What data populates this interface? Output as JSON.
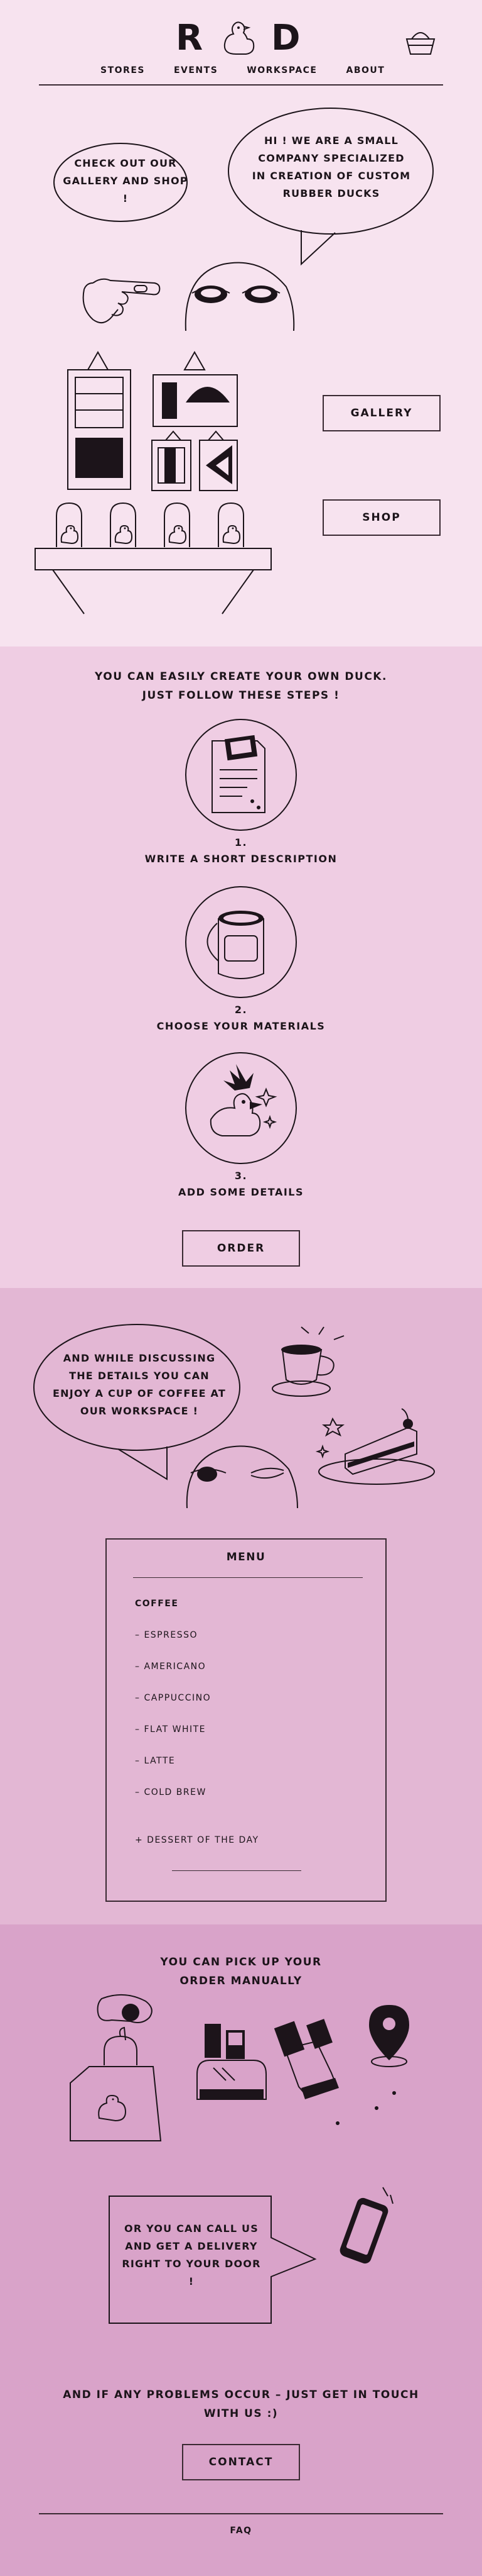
{
  "header": {
    "logo_left": "R",
    "logo_right": "D",
    "nav": [
      "STORES",
      "EVENTS",
      "WORKSPACE",
      "ABOUT"
    ],
    "cart_icon": "basket-icon"
  },
  "hero": {
    "bubble_left": "CHECK OUT OUR GALLERY AND SHOP !",
    "bubble_right": "HI ! WE ARE A SMALL COMPANY SPECIALIZED IN CREATION OF CUSTOM RUBBER DUCKS",
    "gallery_button": "GALLERY",
    "shop_button": "SHOP"
  },
  "steps": {
    "heading_line1": "YOU CAN EASILY CREATE YOUR OWN DUCK.",
    "heading_line2": "JUST FOLLOW THESE STEPS !",
    "items": [
      {
        "number": "1.",
        "label": "WRITE A SHORT DESCRIPTION",
        "icon": "document-icon"
      },
      {
        "number": "2.",
        "label": "CHOOSE YOUR MATERIALS",
        "icon": "paint-bucket-icon"
      },
      {
        "number": "3.",
        "label": "ADD SOME DETAILS",
        "icon": "punk-duck-icon"
      }
    ],
    "order_button": "ORDER"
  },
  "workspace": {
    "bubble": "AND WHILE DISCUSSING THE DETAILS YOU CAN ENJOY A CUP OF COFFEE AT OUR WORKSPACE !",
    "menu": {
      "title": "MENU",
      "category": "COFFEE",
      "items": [
        "– ESPRESSO",
        "– AMERICANO",
        "– CAPPUCCINO",
        "– FLAT WHITE",
        "– LATTE",
        "– COLD BREW"
      ],
      "extra": "+ DESSERT OF THE DAY"
    }
  },
  "pickup": {
    "heading_line1": "YOU CAN PICK UP YOUR",
    "heading_line2": "ORDER MANUALLY",
    "delivery_bubble": "OR YOU CAN CALL US AND GET A DELIVERY RIGHT TO YOUR DOOR !",
    "contact_line1": "AND IF ANY PROBLEMS OCCUR – JUST GET IN TOUCH",
    "contact_line2": "WITH US :)",
    "contact_button": "CONTACT"
  },
  "footer": {
    "faq": "FAQ"
  },
  "colors": {
    "section1": "#f7e3ef",
    "section2": "#efcde3",
    "section3": "#e3b7d4",
    "section4": "#d9a3c9",
    "ink": "#1c141a"
  }
}
